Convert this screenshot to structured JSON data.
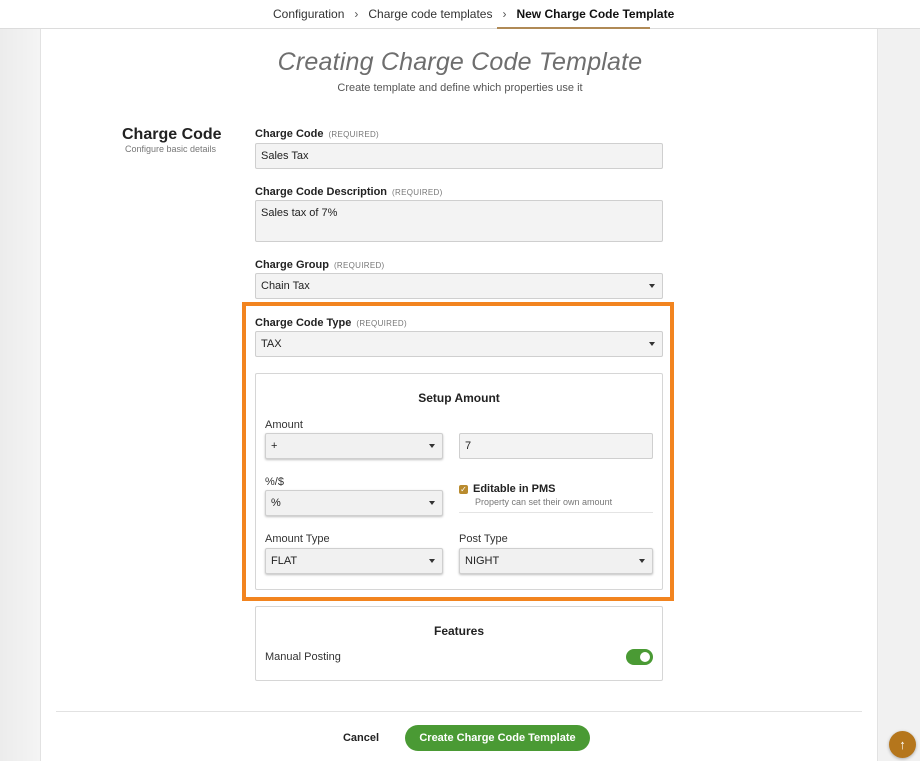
{
  "breadcrumb": {
    "items": [
      "Configuration",
      "Charge code templates",
      "New Charge Code Template"
    ],
    "separator": "›"
  },
  "header": {
    "title": "Creating Charge Code Template",
    "subtitle": "Create template and define which properties use it"
  },
  "section": {
    "title": "Charge Code",
    "subtitle": "Configure basic details"
  },
  "required_tag": "(REQUIRED)",
  "fields": {
    "charge_code": {
      "label": "Charge Code",
      "value": "Sales Tax"
    },
    "description": {
      "label": "Charge Code Description",
      "value": "Sales tax of 7%"
    },
    "charge_group": {
      "label": "Charge Group",
      "value": "Chain Tax"
    },
    "charge_code_type": {
      "label": "Charge Code Type",
      "value": "TAX"
    }
  },
  "setup_amount": {
    "title": "Setup Amount",
    "amount_label": "Amount",
    "amount_sign": "+",
    "amount_value": "7",
    "unit_label": "%/$",
    "unit_value": "%",
    "editable": {
      "label": "Editable in PMS",
      "sub": "Property can set their own amount",
      "checked": true
    },
    "amount_type_label": "Amount Type",
    "amount_type_value": "FLAT",
    "post_type_label": "Post Type",
    "post_type_value": "NIGHT"
  },
  "features": {
    "title": "Features",
    "manual_posting_label": "Manual Posting",
    "manual_posting_on": true
  },
  "actions": {
    "cancel": "Cancel",
    "create": "Create Charge Code Template"
  },
  "colors": {
    "accent_green": "#4a9a34",
    "highlight_orange": "#f2841f",
    "brand_gold": "#b08a56"
  },
  "icons": {
    "scroll_top": "arrow-up-icon"
  }
}
